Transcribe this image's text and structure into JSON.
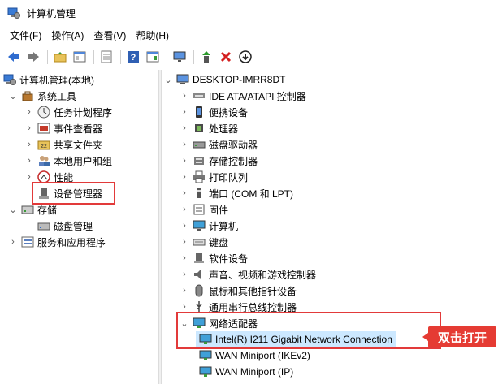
{
  "window": {
    "title": "计算机管理"
  },
  "menu": [
    "文件(F)",
    "操作(A)",
    "查看(V)",
    "帮助(H)"
  ],
  "toolbar_icons": [
    "back-arrow-icon",
    "forward-arrow-icon",
    "folder-up-icon",
    "show-hide-tree-icon",
    "properties-icon",
    "help-icon",
    "action-pane-icon",
    "monitor-icon",
    "update-driver-icon",
    "uninstall-icon",
    "disable-device-icon"
  ],
  "left_tree": {
    "root": "计算机管理(本地)",
    "system_tools": "系统工具",
    "task_scheduler": "任务计划程序",
    "event_viewer": "事件查看器",
    "shared_folders": "共享文件夹",
    "local_users": "本地用户和组",
    "performance": "性能",
    "device_manager": "设备管理器",
    "storage": "存储",
    "disk_management": "磁盘管理",
    "services_apps": "服务和应用程序"
  },
  "right_tree": {
    "computer": "DESKTOP-IMRR8DT",
    "categories": [
      "IDE ATA/ATAPI 控制器",
      "便携设备",
      "处理器",
      "磁盘驱动器",
      "存储控制器",
      "打印队列",
      "端口 (COM 和 LPT)",
      "固件",
      "计算机",
      "键盘",
      "软件设备",
      "声音、视频和游戏控制器",
      "鼠标和其他指针设备",
      "通用串行总线控制器",
      "网络适配器"
    ],
    "network_children": [
      "Intel(R) I211 Gigabit Network Connection",
      "WAN Miniport (IKEv2)",
      "WAN Miniport (IP)"
    ]
  },
  "annotation": {
    "text": "双击打开"
  },
  "colors": {
    "highlight": "#e23a3a",
    "callout": "#e53b33",
    "selection": "#cce8ff"
  }
}
